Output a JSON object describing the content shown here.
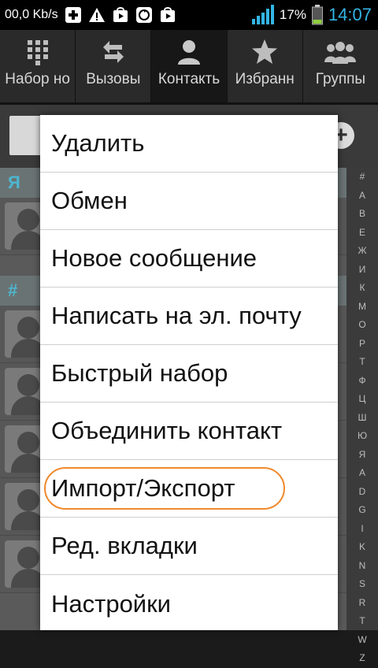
{
  "status_bar": {
    "net_speed": "00,0 Kb/s",
    "battery_percent": "17%",
    "time": "14:07",
    "icons": [
      "medical-plus-icon",
      "warning-icon",
      "play-store-icon",
      "sync-icon",
      "play-store-icon",
      "signal-icon",
      "battery-icon"
    ]
  },
  "tabs": [
    {
      "label": "Набор но",
      "icon": "dialpad-icon",
      "active": false
    },
    {
      "label": "Вызовы",
      "icon": "call-log-icon",
      "active": false
    },
    {
      "label": "Контакть",
      "icon": "contact-icon",
      "active": true
    },
    {
      "label": "Избранн",
      "icon": "star-icon",
      "active": false
    },
    {
      "label": "Группы",
      "icon": "groups-icon",
      "active": false
    }
  ],
  "list": {
    "sections": [
      "Я",
      "#"
    ]
  },
  "alphabet_index": [
    "#",
    "А",
    "В",
    "Е",
    "Ж",
    "И",
    "К",
    "М",
    "О",
    "Р",
    "Т",
    "Ф",
    "Ц",
    "Ш",
    "Ю",
    "Я",
    "A",
    "D",
    "G",
    "I",
    "K",
    "N",
    "S",
    "R",
    "T",
    "W",
    "Z"
  ],
  "menu": {
    "items": [
      {
        "label": "Удалить"
      },
      {
        "label": "Обмен"
      },
      {
        "label": "Новое сообщение"
      },
      {
        "label": "Написать на эл. почту"
      },
      {
        "label": "Быстрый набор"
      },
      {
        "label": "Объединить контакт"
      },
      {
        "label": "Импорт/Экспорт",
        "highlighted": true
      },
      {
        "label": "Ред. вкладки"
      },
      {
        "label": "Настройки"
      }
    ]
  },
  "colors": {
    "accent": "#33b5e5",
    "highlight_ring": "#f08a2c"
  }
}
